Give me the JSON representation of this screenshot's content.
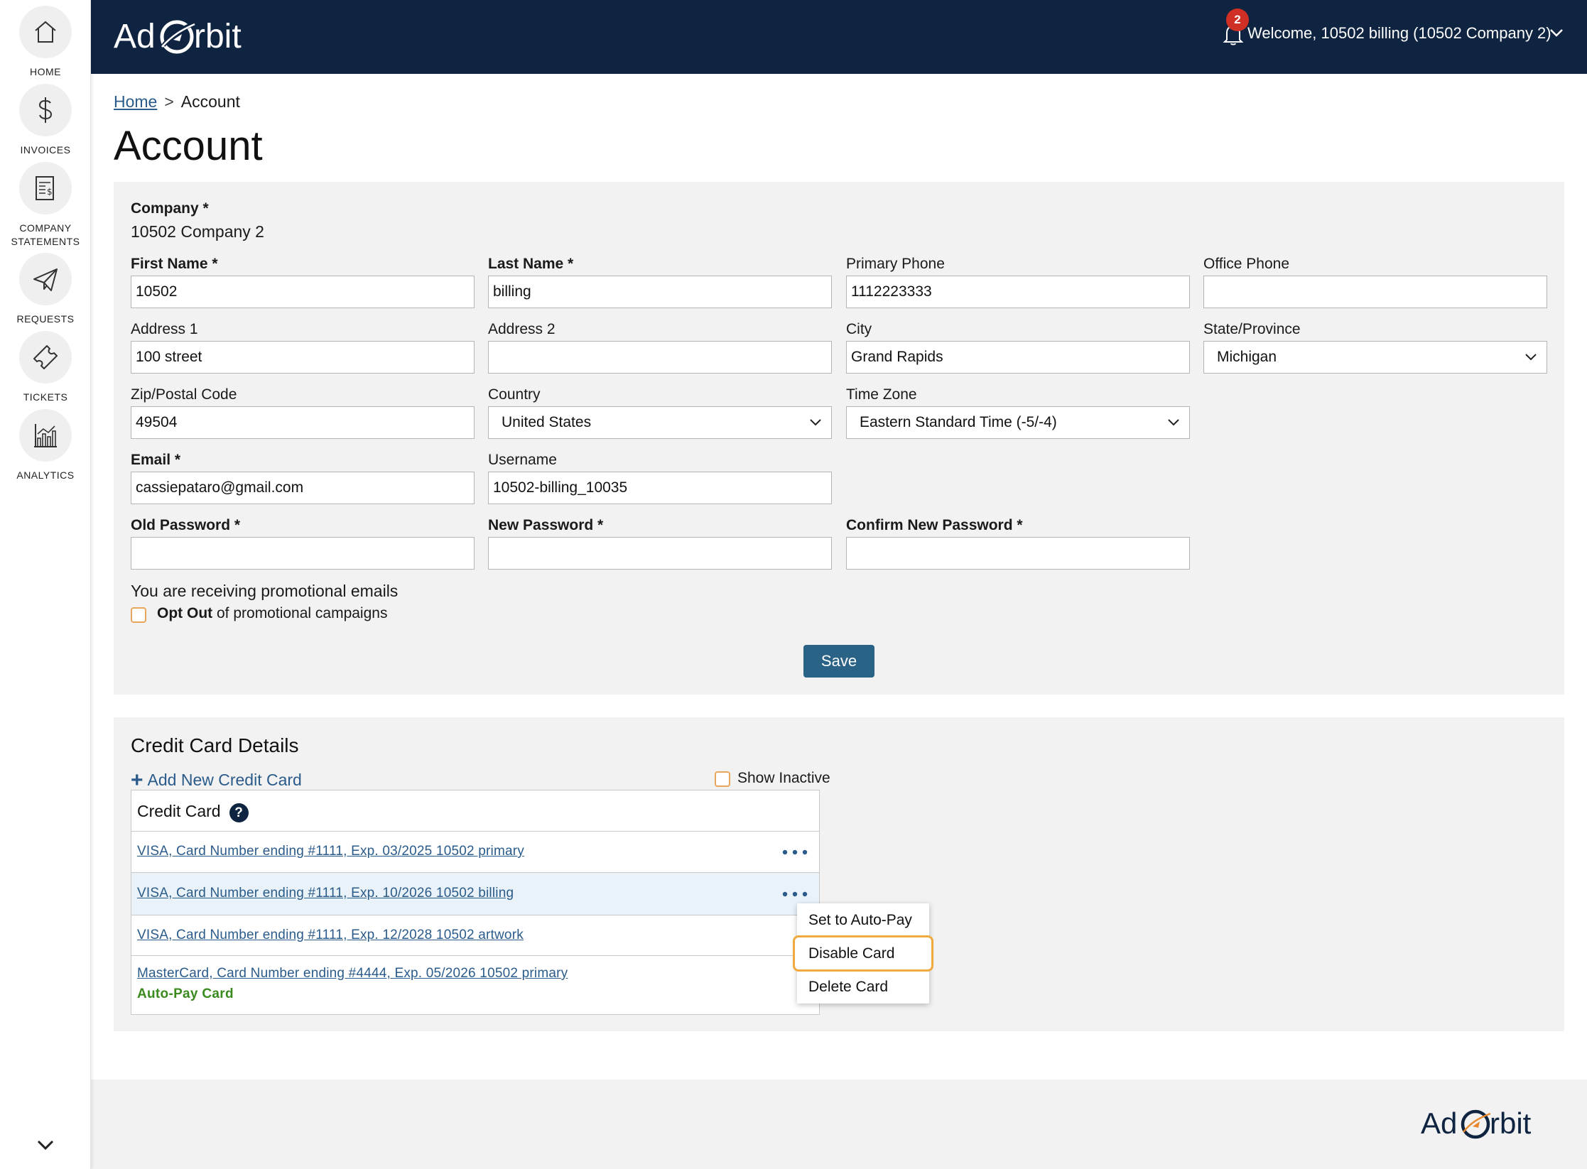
{
  "brand": {
    "name": "AdOrbit",
    "navy": "#0f2440",
    "link_blue": "#2a5b8a",
    "button_blue": "#2b6386",
    "badge_red": "#cf2f24",
    "autopay_green": "#3a8a1e"
  },
  "sidebar": {
    "items": [
      {
        "label": "HOME",
        "icon": "home-icon"
      },
      {
        "label": "INVOICES",
        "icon": "dollar-icon"
      },
      {
        "label": "COMPANY STATEMENTS",
        "icon": "statement-icon"
      },
      {
        "label": "REQUESTS",
        "icon": "paper-plane-icon"
      },
      {
        "label": "TICKETS",
        "icon": "ticket-icon"
      },
      {
        "label": "ANALYTICS",
        "icon": "analytics-icon"
      }
    ]
  },
  "header": {
    "notification_count": "2",
    "welcome": "Welcome, 10502 billing (10502 Company 2)"
  },
  "breadcrumb": {
    "home": "Home",
    "separator": ">",
    "current": "Account"
  },
  "page_title": "Account",
  "form": {
    "company_label": "Company *",
    "company_value": "10502 Company 2",
    "first_name": {
      "label": "First Name *",
      "value": "10502"
    },
    "last_name": {
      "label": "Last Name *",
      "value": "billing"
    },
    "primary_phone": {
      "label": "Primary Phone",
      "value": "1112223333"
    },
    "office_phone": {
      "label": "Office Phone",
      "value": ""
    },
    "address1": {
      "label": "Address 1",
      "value": "100 street"
    },
    "address2": {
      "label": "Address 2",
      "value": ""
    },
    "city": {
      "label": "City",
      "value": "Grand Rapids"
    },
    "state": {
      "label": "State/Province",
      "value": "Michigan"
    },
    "zip": {
      "label": "Zip/Postal Code",
      "value": "49504"
    },
    "country": {
      "label": "Country",
      "value": "United States"
    },
    "timezone": {
      "label": "Time Zone",
      "value": "Eastern Standard Time (-5/-4)"
    },
    "email": {
      "label": "Email *",
      "value": "cassiepataro@gmail.com"
    },
    "username": {
      "label": "Username",
      "value": "10502-billing_10035"
    },
    "old_password": {
      "label": "Old Password *",
      "value": ""
    },
    "new_password": {
      "label": "New Password *",
      "value": ""
    },
    "confirm_password": {
      "label": "Confirm New Password *",
      "value": ""
    },
    "promo_text": "You are receiving promotional emails",
    "opt_out_bold": "Opt Out",
    "opt_out_rest": " of promotional campaigns",
    "save_label": "Save"
  },
  "credit_cards": {
    "title": "Credit Card Details",
    "add_label": "Add New Credit Card",
    "show_inactive_label": "Show Inactive",
    "column_header": "Credit Card",
    "help_glyph": "?",
    "rows": [
      {
        "text": "VISA, Card Number ending #1111, Exp. 03/2025 10502 primary"
      },
      {
        "text": "VISA, Card Number ending #1111, Exp. 10/2026 10502 billing"
      },
      {
        "text": "VISA, Card Number ending #1111, Exp. 12/2028 10502 artwork"
      },
      {
        "text": "MasterCard, Card Number ending #4444, Exp. 05/2026 10502 primary",
        "badge": "Auto-Pay Card"
      }
    ],
    "context_menu": [
      "Set to Auto-Pay",
      "Disable Card",
      "Delete Card"
    ]
  }
}
